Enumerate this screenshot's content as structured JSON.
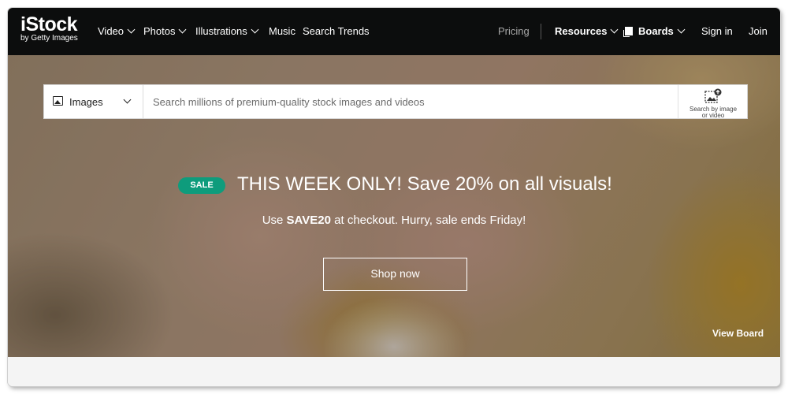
{
  "nav": {
    "logo_brand": "iStock",
    "logo_sub": "by Getty Images",
    "video": "Video",
    "photos": "Photos",
    "illustrations": "Illustrations",
    "music": "Music",
    "search_trends": "Search Trends",
    "pricing": "Pricing",
    "resources": "Resources",
    "boards": "Boards",
    "sign_in": "Sign in",
    "join": "Join"
  },
  "search": {
    "type_selected": "Images",
    "placeholder": "Search millions of premium-quality stock images and videos",
    "value": "",
    "image_search_line1": "Search by image",
    "image_search_line2": "or video"
  },
  "promo": {
    "badge": "SALE",
    "headline": "THIS WEEK ONLY! Save 20% on all visuals!",
    "sub_prefix": "Use ",
    "sub_code": "SAVE20",
    "sub_suffix": " at checkout. Hurry, sale ends Friday!",
    "button": "Shop now"
  },
  "hero": {
    "view_board": "View Board"
  },
  "colors": {
    "nav_bg": "#0c0d0d",
    "sale_badge": "#0e9c7c",
    "text_on_dark": "#ffffff",
    "pricing_text": "#a8a8a8"
  },
  "icons": [
    "chevron-down-icon",
    "board-icon",
    "image-icon",
    "image-search-icon"
  ]
}
